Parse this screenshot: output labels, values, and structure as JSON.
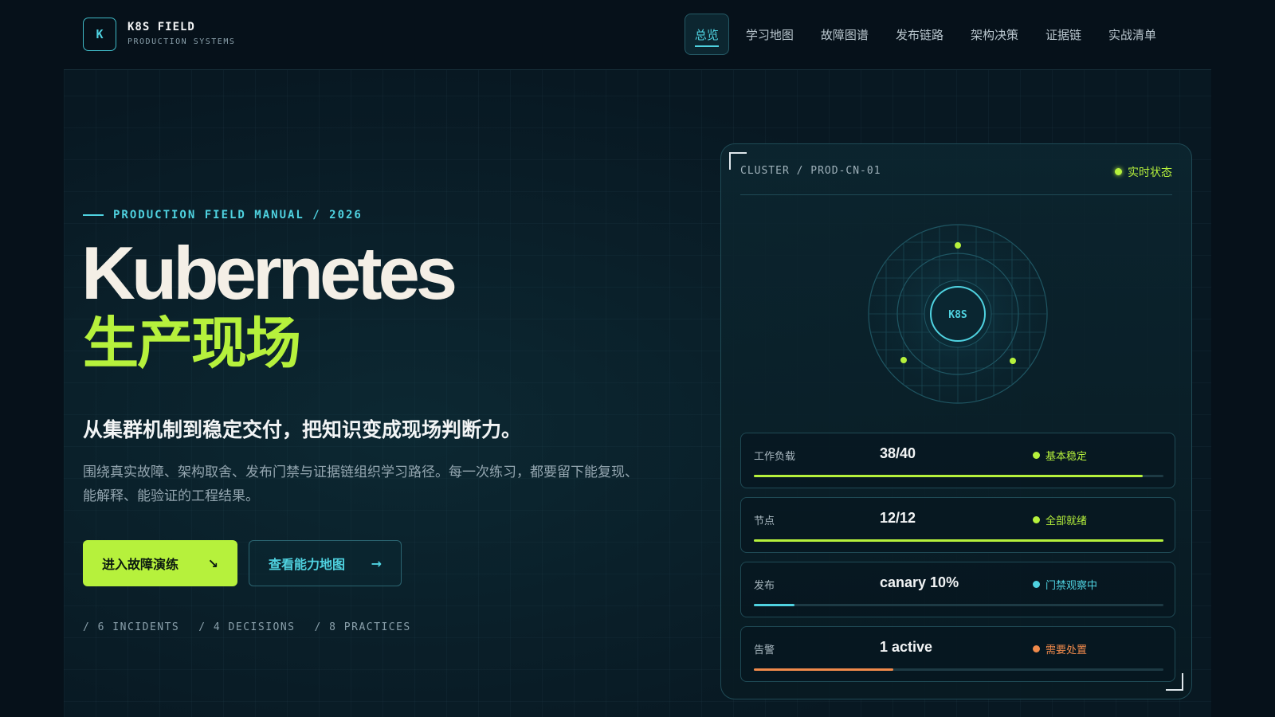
{
  "brand": {
    "mark": "K",
    "title": "K8S FIELD",
    "subtitle": "PRODUCTION SYSTEMS"
  },
  "nav": [
    {
      "label": "总览",
      "active": true
    },
    {
      "label": "学习地图"
    },
    {
      "label": "故障图谱"
    },
    {
      "label": "发布链路"
    },
    {
      "label": "架构决策"
    },
    {
      "label": "证据链"
    },
    {
      "label": "实战清单"
    }
  ],
  "hero": {
    "eyebrow": "PRODUCTION FIELD MANUAL / 2026",
    "title": "Kubernetes",
    "title_cn": "生产现场",
    "headline": "从集群机制到稳定交付，把知识变成现场判断力。",
    "description": "围绕真实故障、架构取舍、发布门禁与证据链组织学习路径。每一次练习，都要留下能复现、能解释、能验证的工程结果。",
    "primary_button": {
      "label": "进入故障演练",
      "arrow": "↘"
    },
    "secondary_button": {
      "label": "查看能力地图",
      "arrow": "→"
    },
    "stats": [
      "/ 6 INCIDENTS",
      "/ 4 DECISIONS",
      "/ 8 PRACTICES"
    ]
  },
  "panel": {
    "cluster": "CLUSTER / PROD-CN-01",
    "live_label": "实时状态",
    "core_label": "K8S",
    "colors": {
      "lime": "#b6f13c",
      "cyan": "#4fd2e0",
      "orange": "#f08a4b"
    },
    "metrics": [
      {
        "label": "工作负载",
        "value": "38/40",
        "status": "基本稳定",
        "color": "#b6f13c",
        "progress": 0.95
      },
      {
        "label": "节点",
        "value": "12/12",
        "status": "全部就绪",
        "color": "#b6f13c",
        "progress": 1.0
      },
      {
        "label": "发布",
        "value": "canary 10%",
        "status": "门禁观察中",
        "color": "#4fd2e0",
        "progress": 0.1
      },
      {
        "label": "告警",
        "value": "1 active",
        "status": "需要处置",
        "color": "#f08a4b",
        "progress": 0.34
      }
    ]
  }
}
